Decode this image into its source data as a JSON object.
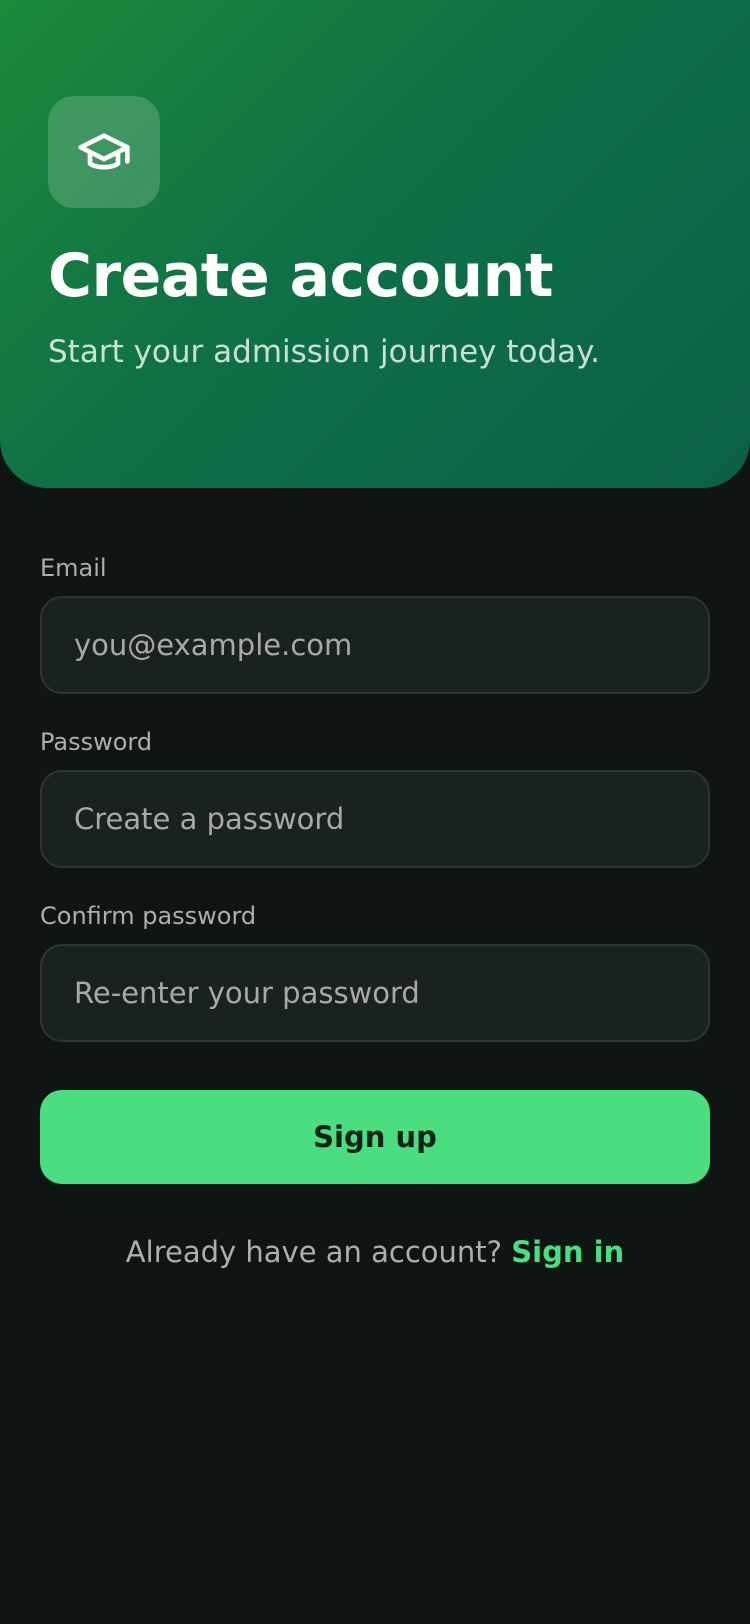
{
  "header": {
    "title": "Create account",
    "subtitle": "Start your admission journey today.",
    "logo_icon": "graduation-cap-icon"
  },
  "form": {
    "email": {
      "label": "Email",
      "placeholder": "you@example.com",
      "value": ""
    },
    "password": {
      "label": "Password",
      "placeholder": "Create a password",
      "value": ""
    },
    "confirm_password": {
      "label": "Confirm password",
      "placeholder": "Re-enter your password",
      "value": ""
    },
    "submit_label": "Sign up"
  },
  "footer": {
    "prompt": "Already have an account?",
    "link_label": "Sign in"
  },
  "colors": {
    "accent": "#4ade80",
    "background": "#0e1512",
    "header_gradient_start": "#1b8a3a",
    "header_gradient_end": "#0a6048"
  }
}
